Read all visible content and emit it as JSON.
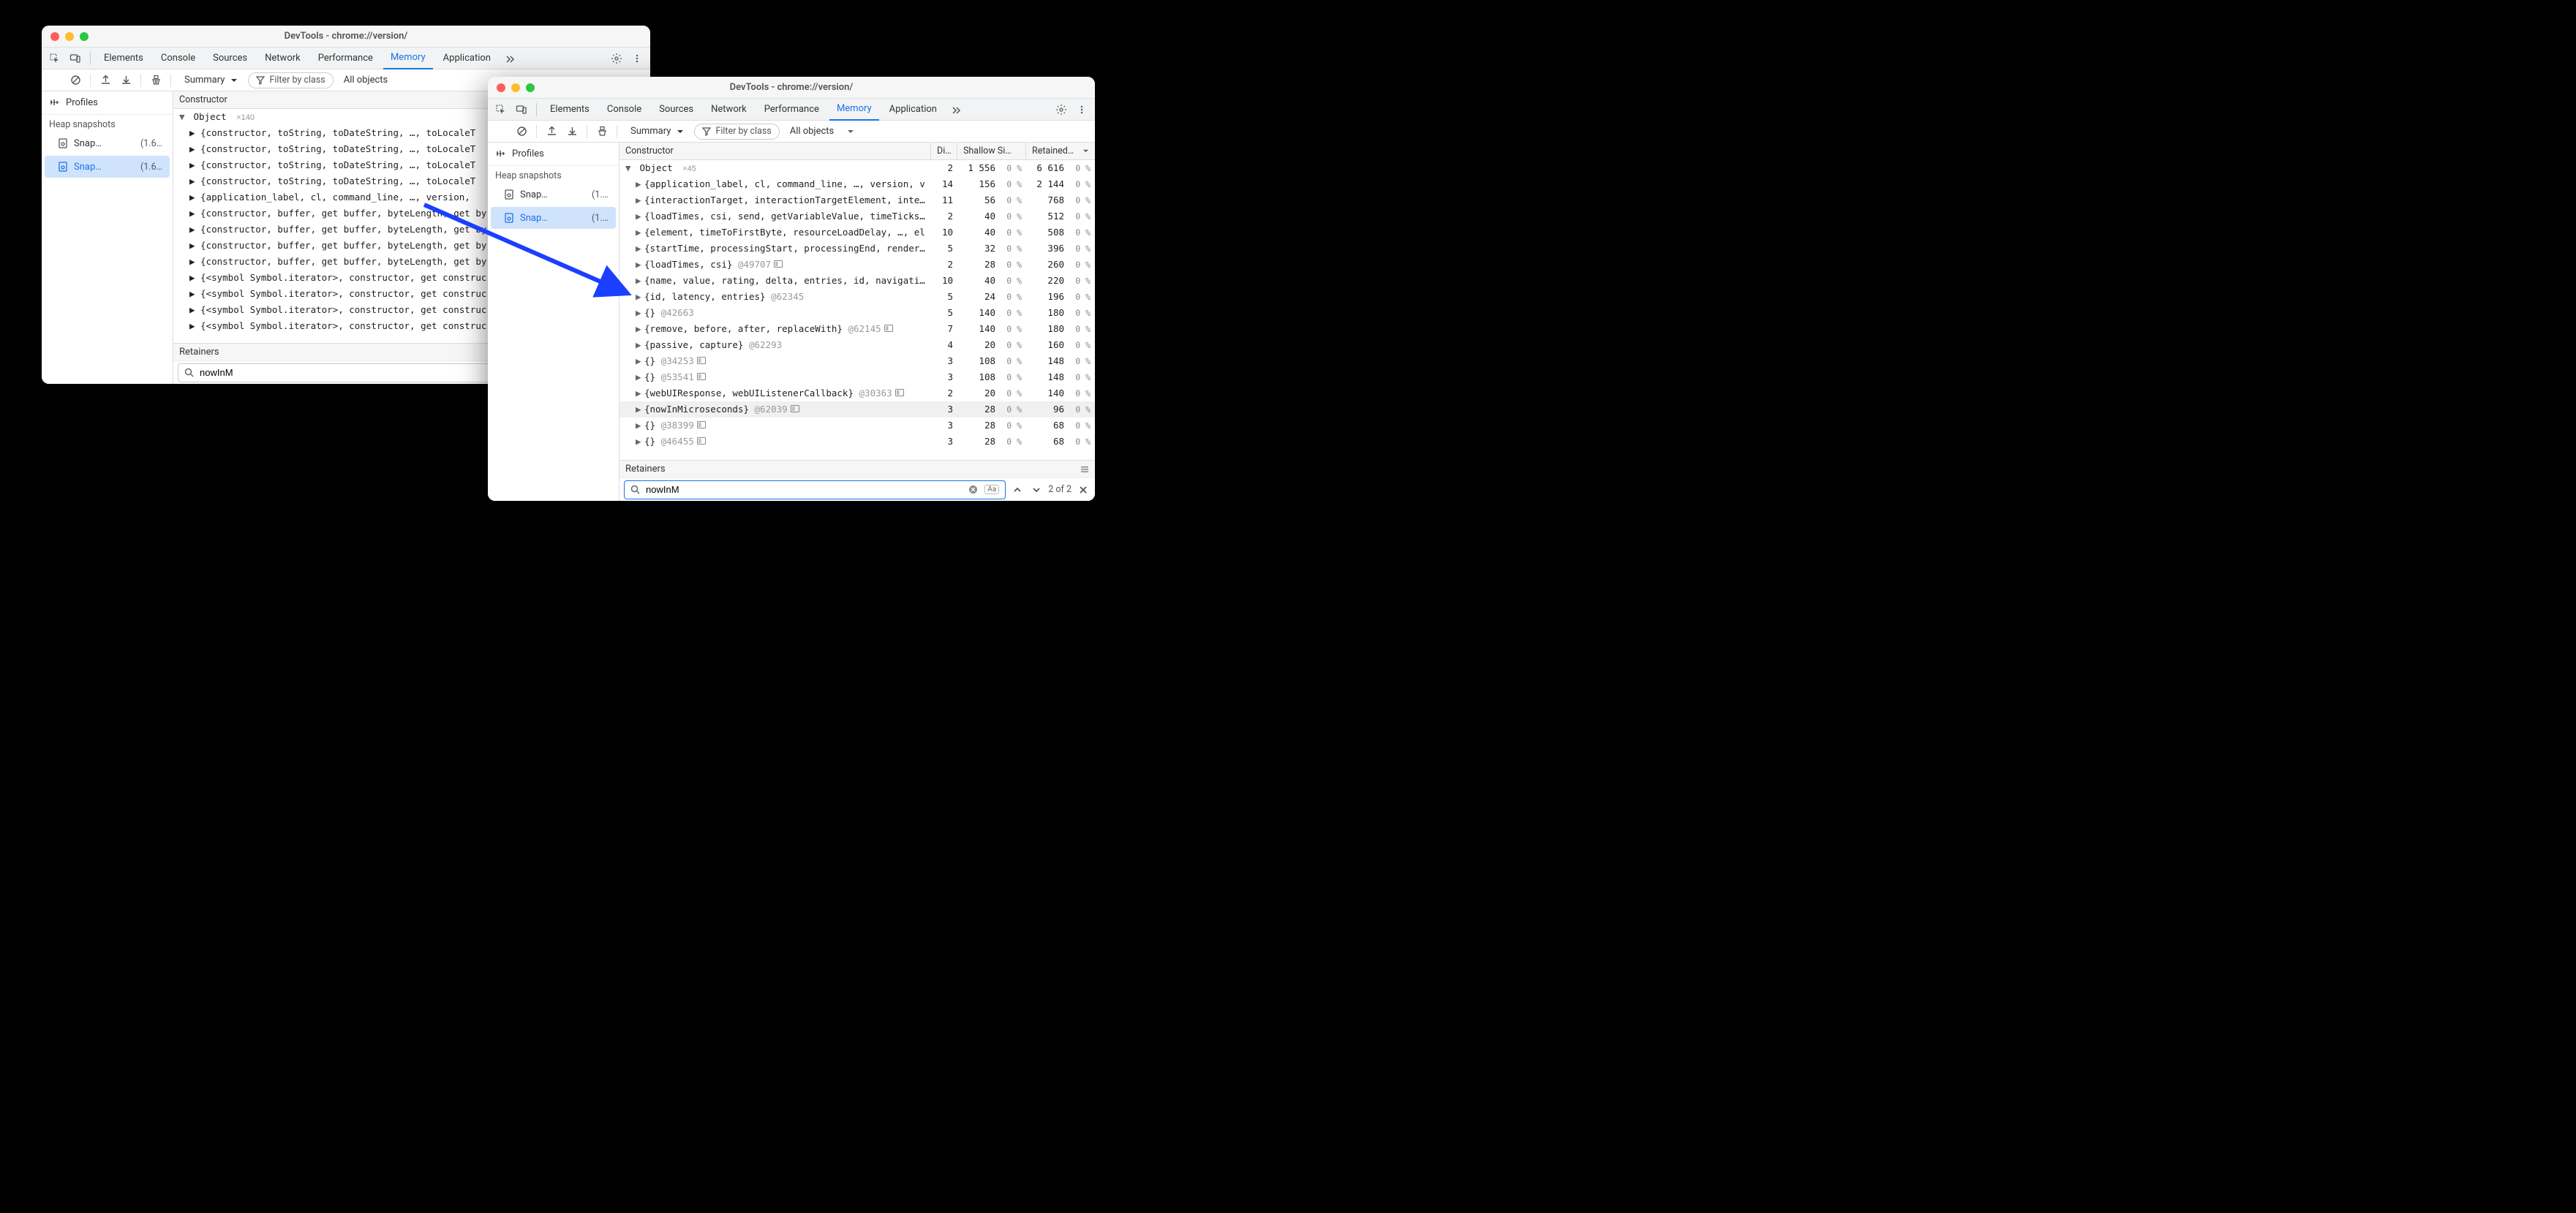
{
  "windowA": {
    "title": "DevTools - chrome://version/",
    "tabs": [
      "Elements",
      "Console",
      "Sources",
      "Network",
      "Performance",
      "Memory",
      "Application"
    ],
    "activeTab": "Memory",
    "filterPlaceholder": "Filter by class",
    "view": "Summary",
    "scope": "All objects",
    "sideTitle": "Profiles",
    "heapSection": "Heap snapshots",
    "snapshots": [
      {
        "name": "Snap…",
        "size": "(1.6…"
      },
      {
        "name": "Snap…",
        "size": "(1.6…"
      }
    ],
    "constructorHdr": "Constructor",
    "retainersLabel": "Retainers",
    "searchValue": "nowInM",
    "parent": {
      "label": "Object",
      "count": "×140"
    },
    "rows": [
      "▶ {constructor, toString, toDateString, …, toLocaleT",
      "▶ {constructor, toString, toDateString, …, toLocaleT",
      "▶ {constructor, toString, toDateString, …, toLocaleT",
      "▶ {constructor, toString, toDateString, …, toLocaleT",
      "▶ {application_label, cl, command_line, …, version, ",
      "▶ {constructor, buffer, get buffer, byteLength, get by",
      "▶ {constructor, buffer, get buffer, byteLength, get by",
      "▶ {constructor, buffer, get buffer, byteLength, get by",
      "▶ {constructor, buffer, get buffer, byteLength, get by",
      "▶ {<symbol Symbol.iterator>, constructor, get construc",
      "▶ {<symbol Symbol.iterator>, constructor, get construc",
      "▶ {<symbol Symbol.iterator>, constructor, get construc",
      "▶ {<symbol Symbol.iterator>, constructor, get construc"
    ]
  },
  "windowB": {
    "title": "DevTools - chrome://version/",
    "tabs": [
      "Elements",
      "Console",
      "Sources",
      "Network",
      "Performance",
      "Memory",
      "Application"
    ],
    "activeTab": "Memory",
    "filterPlaceholder": "Filter by class",
    "view": "Summary",
    "scope": "All objects",
    "sideTitle": "Profiles",
    "heapSection": "Heap snapshots",
    "snapshots": [
      {
        "name": "Snap…",
        "size": "(1.…"
      },
      {
        "name": "Snap…",
        "size": "(1.…"
      }
    ],
    "cols": [
      "Constructor",
      "Di…",
      "Shallow Si…",
      "Retained…"
    ],
    "retainersLabel": "Retainers",
    "searchValue": "nowInM",
    "searchCount": "2 of 2",
    "parent": {
      "label": "Object",
      "count": "×45",
      "di": "2",
      "ss": "1 556",
      "sspct": "0 %",
      "rs": "6 616",
      "rspct": "0 %"
    },
    "rows": [
      {
        "text": "{application_label, cl, command_line, …, version, v",
        "di": "14",
        "ss": "156",
        "sspct": "0 %",
        "rs": "2 144",
        "rspct": "0 %"
      },
      {
        "text": "{interactionTarget, interactionTargetElement, interac",
        "di": "11",
        "ss": "56",
        "sspct": "0 %",
        "rs": "768",
        "rspct": "0 %"
      },
      {
        "text": "{loadTimes, csi, send, getVariableValue, timeTicks}",
        "dim": "@",
        "di": "2",
        "ss": "40",
        "sspct": "0 %",
        "rs": "512",
        "rspct": "0 %"
      },
      {
        "text": "{element, timeToFirstByte, resourceLoadDelay, …, el",
        "di": "10",
        "ss": "40",
        "sspct": "0 %",
        "rs": "508",
        "rspct": "0 %"
      },
      {
        "text": "{startTime, processingStart, processingEnd, renderTim",
        "di": "5",
        "ss": "32",
        "sspct": "0 %",
        "rs": "396",
        "rspct": "0 %"
      },
      {
        "text": "{loadTimes, csi}",
        "dim": "@49707",
        "ctx": true,
        "di": "2",
        "ss": "28",
        "sspct": "0 %",
        "rs": "260",
        "rspct": "0 %"
      },
      {
        "text": "{name, value, rating, delta, entries, id, navigationT",
        "di": "10",
        "ss": "40",
        "sspct": "0 %",
        "rs": "220",
        "rspct": "0 %"
      },
      {
        "text": "{id, latency, entries}",
        "dim": "@62345",
        "di": "5",
        "ss": "24",
        "sspct": "0 %",
        "rs": "196",
        "rspct": "0 %"
      },
      {
        "text": "{}",
        "dim": "@42663",
        "di": "5",
        "ss": "140",
        "sspct": "0 %",
        "rs": "180",
        "rspct": "0 %"
      },
      {
        "text": "{remove, before, after, replaceWith}",
        "dim": "@62145",
        "ctx": true,
        "di": "7",
        "ss": "140",
        "sspct": "0 %",
        "rs": "180",
        "rspct": "0 %"
      },
      {
        "text": "{passive, capture}",
        "dim": "@62293",
        "di": "4",
        "ss": "20",
        "sspct": "0 %",
        "rs": "160",
        "rspct": "0 %"
      },
      {
        "text": "{}",
        "dim": "@34253",
        "ctx": true,
        "di": "3",
        "ss": "108",
        "sspct": "0 %",
        "rs": "148",
        "rspct": "0 %"
      },
      {
        "text": "{}",
        "dim": "@53541",
        "ctx": true,
        "di": "3",
        "ss": "108",
        "sspct": "0 %",
        "rs": "148",
        "rspct": "0 %"
      },
      {
        "text": "{webUIResponse, webUIListenerCallback}",
        "dim": "@30363",
        "ctx": true,
        "di": "2",
        "ss": "20",
        "sspct": "0 %",
        "rs": "140",
        "rspct": "0 %"
      },
      {
        "text": "{nowInMicroseconds}",
        "dim": "@62039",
        "ctx": true,
        "di": "3",
        "ss": "28",
        "sspct": "0 %",
        "rs": "96",
        "rspct": "0 %",
        "hl": true
      },
      {
        "text": "{}",
        "dim": "@38399",
        "ctx": true,
        "di": "3",
        "ss": "28",
        "sspct": "0 %",
        "rs": "68",
        "rspct": "0 %"
      },
      {
        "text": "{}",
        "dim": "@46455",
        "ctx": true,
        "di": "3",
        "ss": "28",
        "sspct": "0 %",
        "rs": "68",
        "rspct": "0 %"
      }
    ]
  }
}
